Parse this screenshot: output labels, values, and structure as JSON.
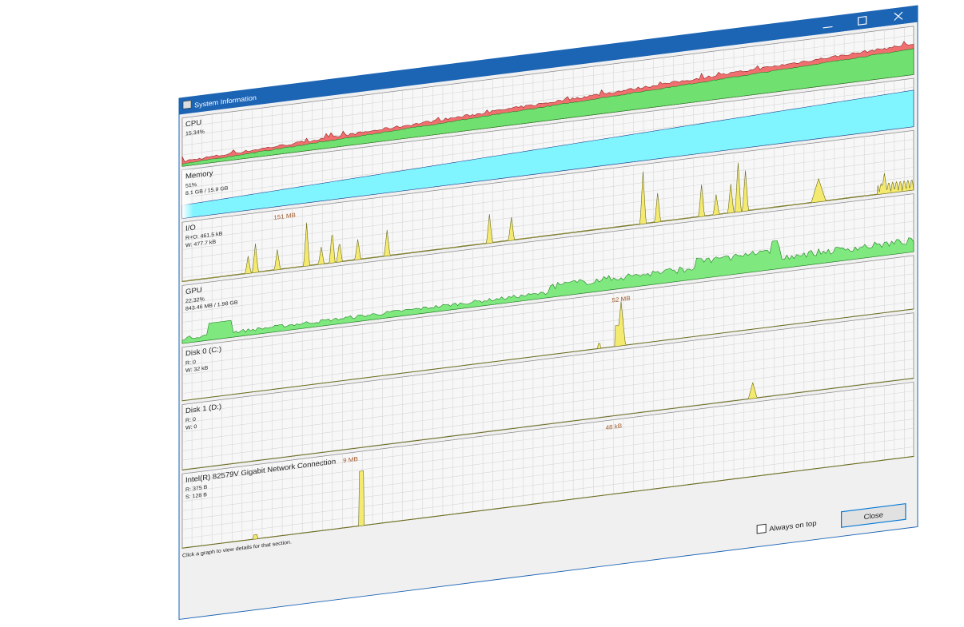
{
  "window": {
    "title": "System Information",
    "minimize_glyph": "—",
    "maximize_glyph": "☐",
    "close_glyph": "✕",
    "accent": "#1c64b4"
  },
  "panels": [
    {
      "id": "cpu",
      "name": "CPU",
      "lines": [
        "15.34%"
      ],
      "annotations": []
    },
    {
      "id": "memory",
      "name": "Memory",
      "lines": [
        "51%",
        "8.1 GB / 15.9 GB"
      ],
      "annotations": []
    },
    {
      "id": "io",
      "name": "I/O",
      "lines": [
        "R+O: 461.5 kB",
        "W: 477.7 kB"
      ],
      "annotations": [
        {
          "text": "151 MB"
        }
      ]
    },
    {
      "id": "gpu",
      "name": "GPU",
      "lines": [
        "22.32%",
        "843.46 MB / 1.98 GB"
      ],
      "annotations": []
    },
    {
      "id": "disk0",
      "name": "Disk 0 (C:)",
      "lines": [
        "R: 0",
        "W: 32 kB"
      ],
      "annotations": [
        {
          "text": "52 MB"
        }
      ]
    },
    {
      "id": "disk1",
      "name": "Disk 1 (D:)",
      "lines": [
        "R: 0",
        "W: 0"
      ],
      "annotations": []
    },
    {
      "id": "net",
      "name": "Intel(R) 82579V Gigabit Network Connection",
      "lines": [
        "R: 375 B",
        "S: 128 B"
      ],
      "annotations": [
        {
          "text": "9 MB"
        },
        {
          "text": "48 kB"
        }
      ]
    }
  ],
  "footer": {
    "hint": "Click a graph to view details for that section.",
    "always_on_top_label": "Always on top",
    "always_on_top_checked": false,
    "close_label": "Close"
  },
  "colors": {
    "cpu_total": "#f07070",
    "cpu_kernel": "#70e070",
    "memory": "#80f4ff",
    "io": "#f5ea70",
    "gpu": "#7fe87f",
    "disk": "#f5ea70",
    "grid": "#d0d0d0",
    "panel_bg": "#f7f7f7",
    "annotation": "#a05a2c"
  }
}
